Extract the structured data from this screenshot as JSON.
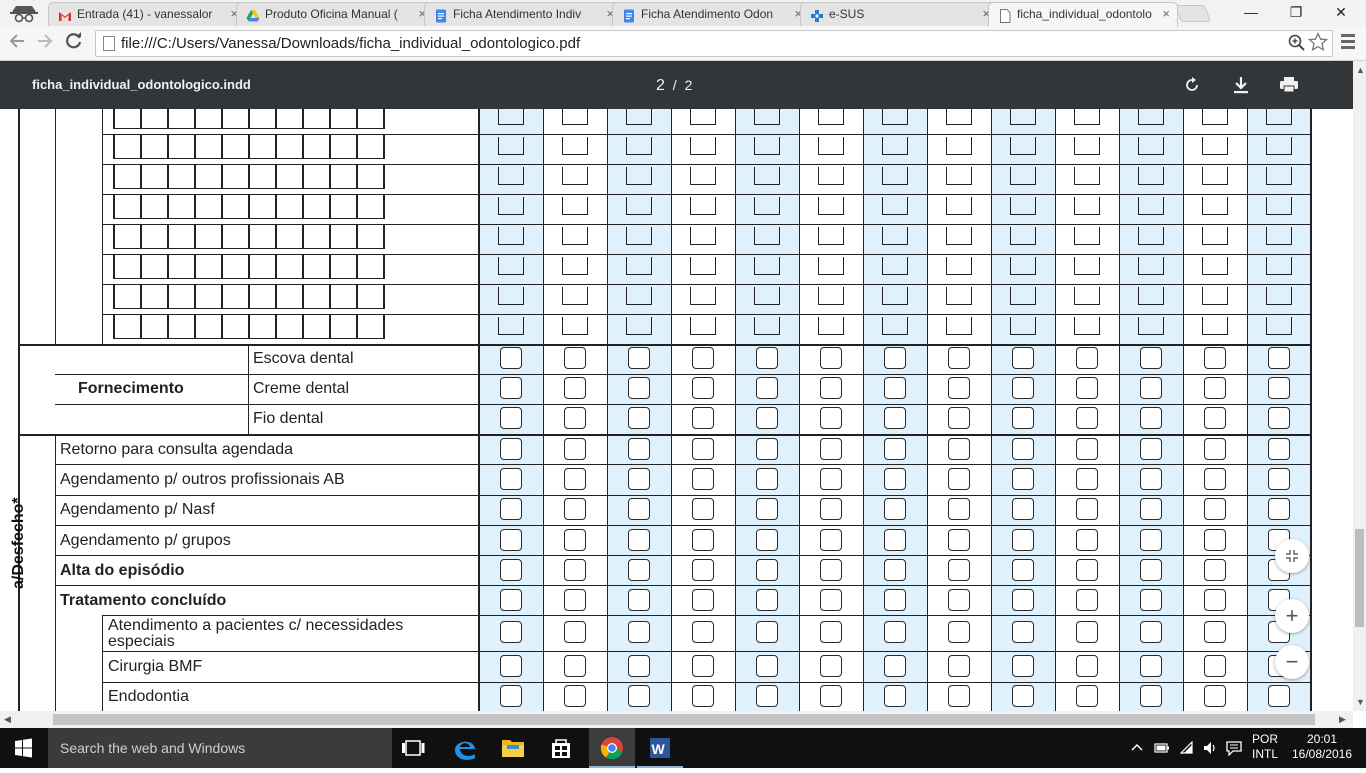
{
  "browser": {
    "tabs": [
      {
        "label": "Entrada (41) - vanessalor",
        "icon": "gmail-icon"
      },
      {
        "label": "Produto Oficina Manual (",
        "icon": "google-drive-icon"
      },
      {
        "label": "Ficha Atendimento Indiv",
        "icon": "google-docs-icon"
      },
      {
        "label": "Ficha Atendimento Odon",
        "icon": "google-docs-icon"
      },
      {
        "label": "e-SUS",
        "icon": "esus-icon"
      },
      {
        "label": "ficha_individual_odontolo",
        "icon": "page-icon",
        "active": true
      }
    ],
    "close_glyph": "×",
    "window": {
      "minimize": "—",
      "restore": "❐",
      "close": "✕"
    },
    "url": "file:///C:/Users/Vanessa/Downloads/ficha_individual_odontologico.pdf"
  },
  "pdf_viewer": {
    "title": "ficha_individual_odontologico.indd",
    "current_page": "2",
    "separator": "/",
    "total_pages": "2"
  },
  "form": {
    "fornecimento_label": "Fornecimento",
    "fornecimento_items": [
      "Escova dental",
      "Creme dental",
      "Fio dental"
    ],
    "conduta_items": [
      {
        "label": "Retorno para consulta agendada",
        "bold": false
      },
      {
        "label": "Agendamento p/ outros profissionais AB",
        "bold": false
      },
      {
        "label": "Agendamento p/ Nasf",
        "bold": false
      },
      {
        "label": "Agendamento p/ grupos",
        "bold": false
      },
      {
        "label": "Alta do episódio",
        "bold": true
      },
      {
        "label": "Tratamento concluído",
        "bold": true
      }
    ],
    "tratamento_subitems": [
      "Atendimento a pacientes c/ necessidades especiais",
      "Cirurgia BMF",
      "Endodontia"
    ],
    "side_label": "Conduta/Desfecho*",
    "side_label_visible": "a/Desfecho*",
    "patient_columns": 13
  },
  "taskbar": {
    "search_placeholder": "Search the web and Windows",
    "language_top": "POR",
    "language_bottom": "INTL",
    "time": "20:01",
    "date": "16/08/2016"
  }
}
